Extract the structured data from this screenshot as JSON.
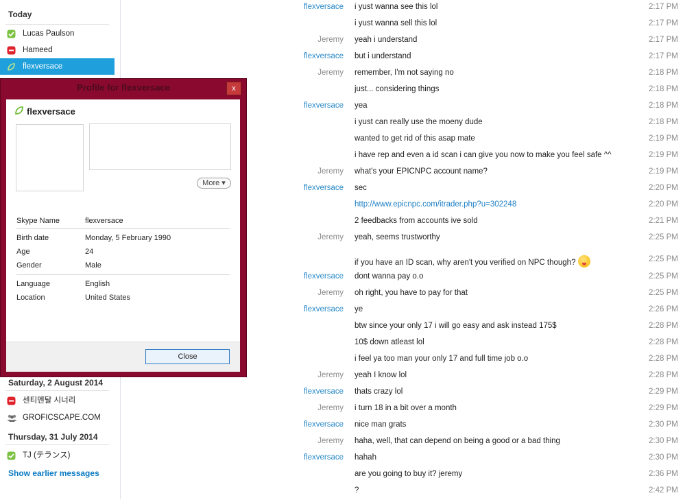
{
  "sidebar": {
    "today_header": "Today",
    "saturday_header": "Saturday, 2 August 2014",
    "thursday_header": "Thursday, 31 July 2014",
    "contacts_today": [
      {
        "name": "Lucas Paulson",
        "status": "online",
        "icon": "online-check-icon"
      },
      {
        "name": "Hameed",
        "status": "offline",
        "icon": "offline-icon"
      },
      {
        "name": "flexversace",
        "status": "online",
        "icon": "online-leaf-icon"
      }
    ],
    "contacts_saturday": [
      {
        "name": "센티멘탈 시너리",
        "status": "offline",
        "icon": "offline-icon"
      },
      {
        "name": "GROFICSCAPE.COM",
        "status": "group",
        "icon": "group-icon"
      }
    ],
    "contacts_thursday": [
      {
        "name": "TJ (テランス)",
        "status": "online",
        "icon": "online-check-icon"
      }
    ],
    "show_earlier": "Show earlier messages"
  },
  "dialog": {
    "title": "Profile for flexversace",
    "close_symbol": "x",
    "profile_name": "flexversace",
    "more_label": "More",
    "fields": [
      {
        "label": "Skype Name",
        "value": "flexversace"
      },
      {
        "label": "Birth date",
        "value": "Monday, 5 February 1990"
      },
      {
        "label": "Age",
        "value": "24"
      },
      {
        "label": "Gender",
        "value": "Male"
      },
      {
        "label": "Language",
        "value": "English"
      },
      {
        "label": "Location",
        "value": "United States"
      }
    ],
    "close_label": "Close"
  },
  "messages": [
    {
      "sender": "flexversace",
      "me": false,
      "text": "i yust wanna see this lol",
      "time": "2:17 PM"
    },
    {
      "sender": "",
      "me": false,
      "text": "i yust wanna sell this lol",
      "time": "2:17 PM"
    },
    {
      "sender": "Jeremy",
      "me": true,
      "text": "yeah i understand",
      "time": "2:17 PM"
    },
    {
      "sender": "flexversace",
      "me": false,
      "text": "but i understand",
      "time": "2:17 PM"
    },
    {
      "sender": "Jeremy",
      "me": true,
      "text": "remember, I'm not saying no",
      "time": "2:18 PM"
    },
    {
      "sender": "",
      "me": true,
      "text": "just... considering things",
      "time": "2:18 PM"
    },
    {
      "sender": "flexversace",
      "me": false,
      "text": "yea",
      "time": "2:18 PM"
    },
    {
      "sender": "",
      "me": false,
      "text": "i yust can really use the moeny dude",
      "time": "2:18 PM"
    },
    {
      "sender": "",
      "me": false,
      "text": "wanted to get rid of this asap mate",
      "time": "2:19 PM"
    },
    {
      "sender": "",
      "me": false,
      "text": " i have rep and even a id scan i can give you now to make you feel safe ^^",
      "time": "2:19 PM"
    },
    {
      "sender": "Jeremy",
      "me": true,
      "text": "what's your EPICNPC account name?",
      "time": "2:19 PM"
    },
    {
      "sender": "flexversace",
      "me": false,
      "text": "sec",
      "time": "2:20 PM"
    },
    {
      "sender": "",
      "me": false,
      "text": "http://www.epicnpc.com/itrader.php?u=302248",
      "time": "2:20 PM",
      "link": true
    },
    {
      "sender": "",
      "me": false,
      "text": "2 feedbacks from accounts ive sold",
      "time": "2:21 PM"
    },
    {
      "sender": "Jeremy",
      "me": true,
      "text": "yeah, seems trustworthy",
      "time": "2:25 PM"
    },
    {
      "sender": "",
      "me": true,
      "text": "if you have an ID scan, why aren't you verified on NPC though?",
      "time": "2:25 PM",
      "emoji": true
    },
    {
      "sender": "flexversace",
      "me": false,
      "text": "dont wanna pay o.o",
      "time": "2:25 PM"
    },
    {
      "sender": "Jeremy",
      "me": true,
      "text": "oh right, you have to pay for that",
      "time": "2:25 PM"
    },
    {
      "sender": "flexversace",
      "me": false,
      "text": "ye",
      "time": "2:26 PM"
    },
    {
      "sender": "",
      "me": false,
      "text": "btw since your only 17 i will go easy and ask instead 175$",
      "time": "2:28 PM"
    },
    {
      "sender": "",
      "me": false,
      "text": "10$ down atleast lol",
      "time": "2:28 PM"
    },
    {
      "sender": "",
      "me": false,
      "text": "i feel ya too man your only 17 and full time job o.o",
      "time": "2:28 PM"
    },
    {
      "sender": "Jeremy",
      "me": true,
      "text": "yeah I know lol",
      "time": "2:28 PM"
    },
    {
      "sender": "flexversace",
      "me": false,
      "text": "thats crazy lol",
      "time": "2:29 PM"
    },
    {
      "sender": "Jeremy",
      "me": true,
      "text": "i turn 18 in a bit over a month",
      "time": "2:29 PM"
    },
    {
      "sender": "flexversace",
      "me": false,
      "text": "nice man grats",
      "time": "2:30 PM"
    },
    {
      "sender": "Jeremy",
      "me": true,
      "text": "haha, well, that can depend on being a good or a bad thing",
      "time": "2:30 PM"
    },
    {
      "sender": "flexversace",
      "me": false,
      "text": "hahah",
      "time": "2:30 PM"
    },
    {
      "sender": "",
      "me": false,
      "text": "are you going to buy it? jeremy",
      "time": "2:36 PM"
    },
    {
      "sender": "",
      "me": false,
      "text": "?",
      "time": "2:42 PM"
    }
  ]
}
